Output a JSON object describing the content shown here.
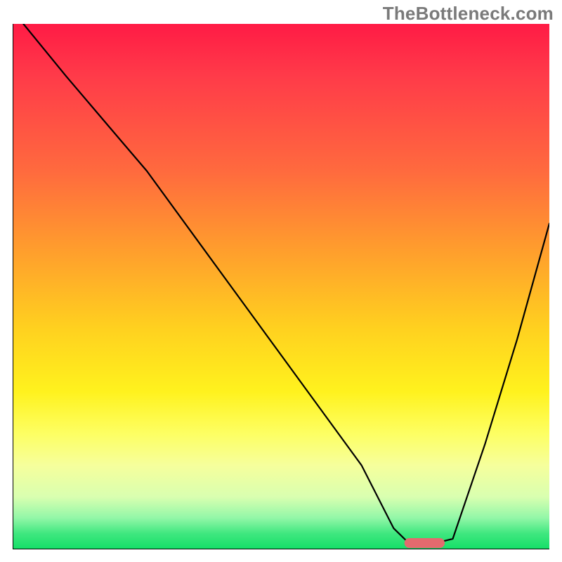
{
  "watermark": "TheBottleneck.com",
  "chart_data": {
    "type": "line",
    "title": "",
    "xlabel": "",
    "ylabel": "",
    "xlim": [
      0,
      100
    ],
    "ylim": [
      0,
      100
    ],
    "grid": false,
    "legend": false,
    "series": [
      {
        "name": "curve",
        "x": [
          2,
          10,
          20,
          25,
          35,
          45,
          55,
          65,
          71,
          74,
          78,
          82,
          88,
          94,
          100
        ],
        "y": [
          100,
          90,
          78,
          72,
          58,
          44,
          30,
          16,
          4,
          1,
          1,
          2,
          20,
          40,
          62
        ]
      }
    ],
    "annotations": [
      {
        "name": "optimal-marker",
        "shape": "rounded-bar",
        "color": "#e46a6e",
        "x_range": [
          73,
          80.5
        ],
        "y": 1.2
      }
    ],
    "background_gradient": {
      "direction": "vertical",
      "stops": [
        {
          "pos": 0.0,
          "color": "#ff1b45"
        },
        {
          "pos": 0.28,
          "color": "#ff6a3e"
        },
        {
          "pos": 0.58,
          "color": "#ffd11f"
        },
        {
          "pos": 0.78,
          "color": "#fdff63"
        },
        {
          "pos": 0.94,
          "color": "#93f7a8"
        },
        {
          "pos": 1.0,
          "color": "#14df67"
        }
      ]
    }
  }
}
